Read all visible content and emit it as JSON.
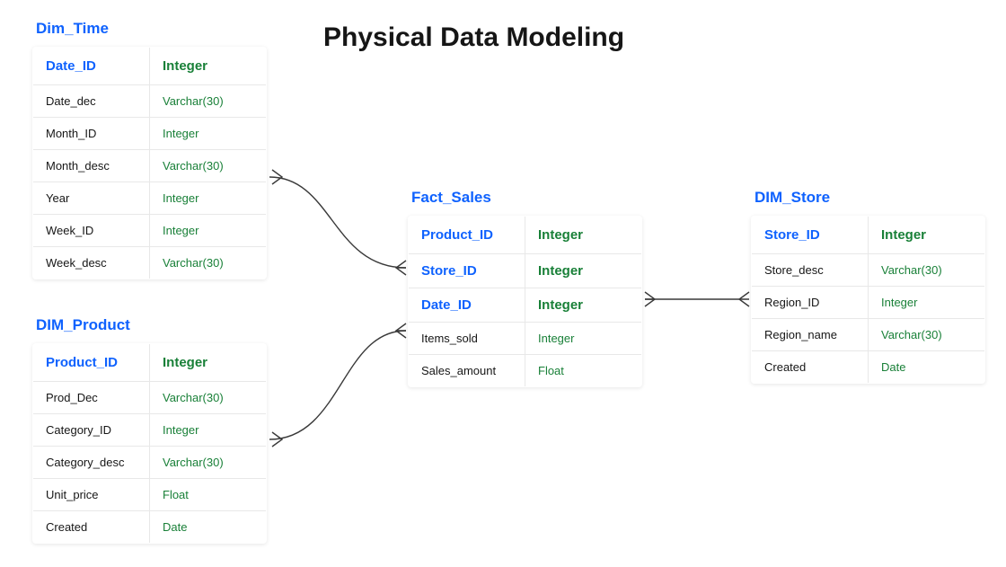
{
  "title": "Physical Data Modeling",
  "entities": {
    "dim_time": {
      "name": "Dim_Time",
      "columns": [
        {
          "name": "Date_ID",
          "type": "Integer",
          "key": "pk"
        },
        {
          "name": "Date_dec",
          "type": "Varchar(30)"
        },
        {
          "name": "Month_ID",
          "type": "Integer"
        },
        {
          "name": "Month_desc",
          "type": "Varchar(30)"
        },
        {
          "name": "Year",
          "type": "Integer"
        },
        {
          "name": "Week_ID",
          "type": "Integer"
        },
        {
          "name": "Week_desc",
          "type": "Varchar(30)"
        }
      ]
    },
    "dim_product": {
      "name": "DIM_Product",
      "columns": [
        {
          "name": "Product_ID",
          "type": "Integer",
          "key": "pk"
        },
        {
          "name": "Prod_Dec",
          "type": "Varchar(30)"
        },
        {
          "name": "Category_ID",
          "type": "Integer"
        },
        {
          "name": "Category_desc",
          "type": "Varchar(30)"
        },
        {
          "name": "Unit_price",
          "type": "Float"
        },
        {
          "name": "Created",
          "type": "Date"
        }
      ]
    },
    "fact_sales": {
      "name": "Fact_Sales",
      "columns": [
        {
          "name": "Product_ID",
          "type": "Integer",
          "key": "fk"
        },
        {
          "name": "Store_ID",
          "type": "Integer",
          "key": "fk"
        },
        {
          "name": "Date_ID",
          "type": "Integer",
          "key": "fk"
        },
        {
          "name": "Items_sold",
          "type": "Integer"
        },
        {
          "name": "Sales_amount",
          "type": "Float"
        }
      ]
    },
    "dim_store": {
      "name": "DIM_Store",
      "columns": [
        {
          "name": "Store_ID",
          "type": "Integer",
          "key": "pk"
        },
        {
          "name": "Store_desc",
          "type": "Varchar(30)"
        },
        {
          "name": "Region_ID",
          "type": "Integer"
        },
        {
          "name": "Region_name",
          "type": "Varchar(30)"
        },
        {
          "name": "Created",
          "type": "Date"
        }
      ]
    }
  },
  "relationships": [
    {
      "from": "dim_time.Date_ID",
      "to": "fact_sales.Date_ID"
    },
    {
      "from": "dim_product.Product_ID",
      "to": "fact_sales.Product_ID"
    },
    {
      "from": "dim_store.Store_ID",
      "to": "fact_sales.Store_ID"
    }
  ]
}
